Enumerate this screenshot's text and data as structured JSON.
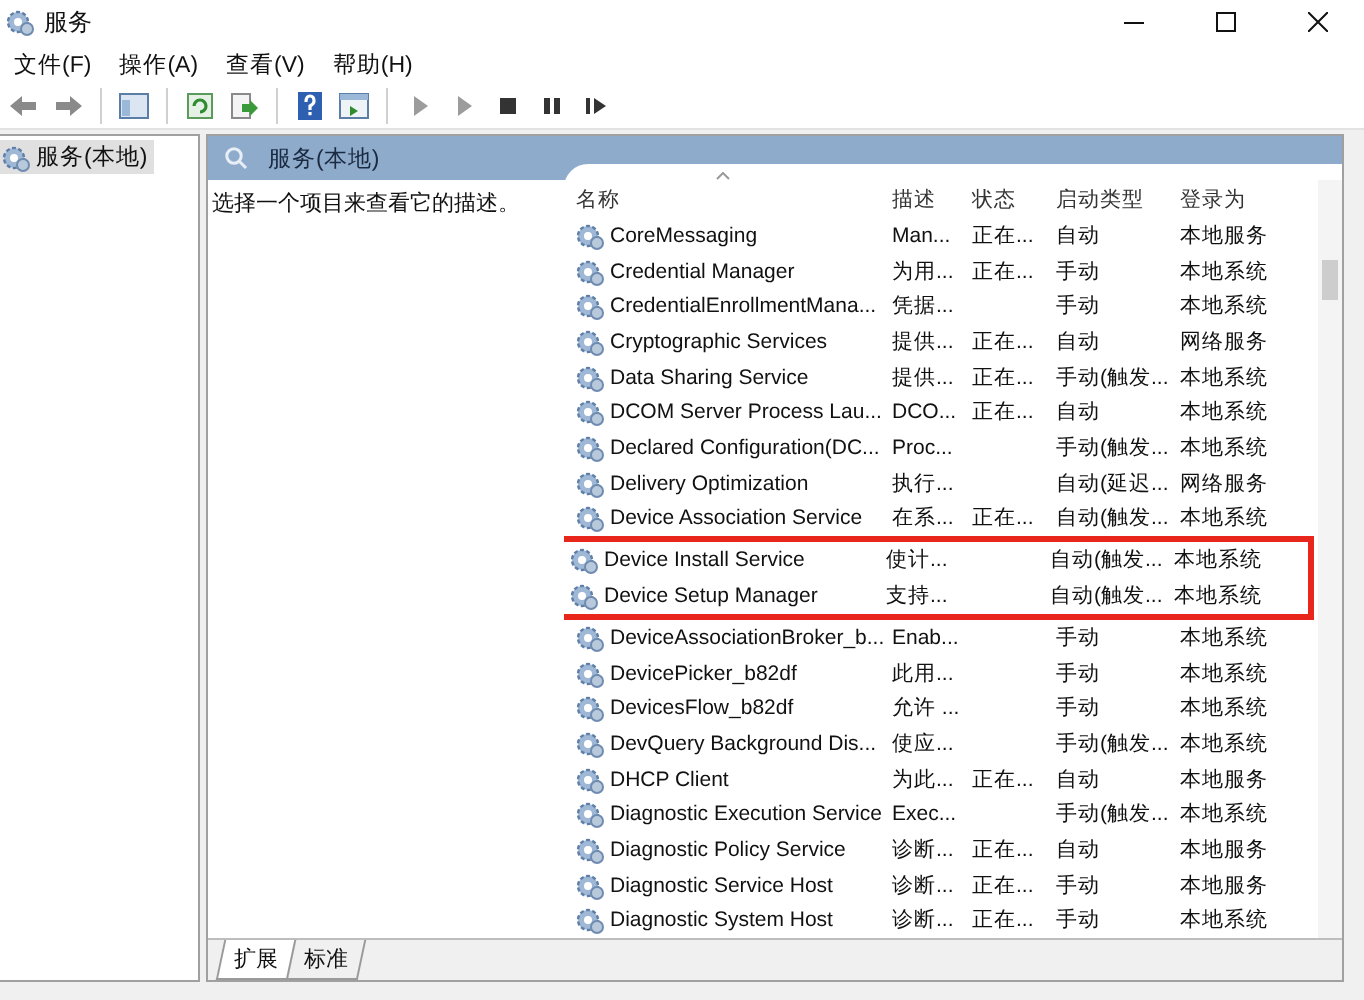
{
  "window": {
    "title": "服务"
  },
  "menu": [
    {
      "label": "文件(F)"
    },
    {
      "label": "操作(A)"
    },
    {
      "label": "查看(V)"
    },
    {
      "label": "帮助(H)"
    }
  ],
  "toolbar": [
    {
      "kind": "back",
      "disabled": false
    },
    {
      "kind": "forward",
      "disabled": false
    },
    {
      "kind": "sep"
    },
    {
      "kind": "tree",
      "disabled": false
    },
    {
      "kind": "sep"
    },
    {
      "kind": "refresh",
      "disabled": false
    },
    {
      "kind": "export",
      "disabled": false
    },
    {
      "kind": "sep"
    },
    {
      "kind": "help",
      "disabled": false
    },
    {
      "kind": "properties",
      "disabled": false
    },
    {
      "kind": "sep"
    },
    {
      "kind": "play",
      "disabled": true
    },
    {
      "kind": "play",
      "disabled": true
    },
    {
      "kind": "stop",
      "disabled": false
    },
    {
      "kind": "pause",
      "disabled": false
    },
    {
      "kind": "resume",
      "disabled": false
    }
  ],
  "tree": {
    "items": [
      {
        "label": "服务(本地)",
        "selected": true
      }
    ]
  },
  "panel": {
    "title": "服务(本地)",
    "description": "选择一个项目来查看它的描述。",
    "columns": [
      {
        "label": "名称",
        "sorted": true
      },
      {
        "label": "描述",
        "sorted": false
      },
      {
        "label": "状态",
        "sorted": false
      },
      {
        "label": "启动类型",
        "sorted": false
      },
      {
        "label": "登录为",
        "sorted": false
      }
    ],
    "rows": [
      {
        "name": "CoreMessaging",
        "description": "Man...",
        "status": "正在...",
        "startup": "自动",
        "logon": "本地服务",
        "highlighted": false
      },
      {
        "name": "Credential Manager",
        "description": "为用...",
        "status": "正在...",
        "startup": "手动",
        "logon": "本地系统",
        "highlighted": false
      },
      {
        "name": "CredentialEnrollmentMana...",
        "description": "凭据...",
        "status": "",
        "startup": "手动",
        "logon": "本地系统",
        "highlighted": false
      },
      {
        "name": "Cryptographic Services",
        "description": "提供...",
        "status": "正在...",
        "startup": "自动",
        "logon": "网络服务",
        "highlighted": false
      },
      {
        "name": "Data Sharing Service",
        "description": "提供...",
        "status": "正在...",
        "startup": "手动(触发...",
        "logon": "本地系统",
        "highlighted": false
      },
      {
        "name": "DCOM Server Process Lau...",
        "description": "DCO...",
        "status": "正在...",
        "startup": "自动",
        "logon": "本地系统",
        "highlighted": false
      },
      {
        "name": "Declared Configuration(DC...",
        "description": "Proc...",
        "status": "",
        "startup": "手动(触发...",
        "logon": "本地系统",
        "highlighted": false
      },
      {
        "name": "Delivery Optimization",
        "description": "执行...",
        "status": "",
        "startup": "自动(延迟...",
        "logon": "网络服务",
        "highlighted": false
      },
      {
        "name": "Device Association Service",
        "description": "在系...",
        "status": "正在...",
        "startup": "自动(触发...",
        "logon": "本地系统",
        "highlighted": false
      },
      {
        "name": "Device Install Service",
        "description": "使计...",
        "status": "",
        "startup": "自动(触发...",
        "logon": "本地系统",
        "highlighted": true
      },
      {
        "name": "Device Setup Manager",
        "description": "支持...",
        "status": "",
        "startup": "自动(触发...",
        "logon": "本地系统",
        "highlighted": true
      },
      {
        "name": "DeviceAssociationBroker_b...",
        "description": "Enab...",
        "status": "",
        "startup": "手动",
        "logon": "本地系统",
        "highlighted": false
      },
      {
        "name": "DevicePicker_b82df",
        "description": "此用...",
        "status": "",
        "startup": "手动",
        "logon": "本地系统",
        "highlighted": false
      },
      {
        "name": "DevicesFlow_b82df",
        "description": "允许 ...",
        "status": "",
        "startup": "手动",
        "logon": "本地系统",
        "highlighted": false
      },
      {
        "name": "DevQuery Background Dis...",
        "description": "使应...",
        "status": "",
        "startup": "手动(触发...",
        "logon": "本地系统",
        "highlighted": false
      },
      {
        "name": "DHCP Client",
        "description": "为此...",
        "status": "正在...",
        "startup": "自动",
        "logon": "本地服务",
        "highlighted": false
      },
      {
        "name": "Diagnostic Execution Service",
        "description": "Exec...",
        "status": "",
        "startup": "手动(触发...",
        "logon": "本地系统",
        "highlighted": false
      },
      {
        "name": "Diagnostic Policy Service",
        "description": "诊断...",
        "status": "正在...",
        "startup": "自动",
        "logon": "本地服务",
        "highlighted": false
      },
      {
        "name": "Diagnostic Service Host",
        "description": "诊断...",
        "status": "正在...",
        "startup": "手动",
        "logon": "本地服务",
        "highlighted": false
      },
      {
        "name": "Diagnostic System Host",
        "description": "诊断...",
        "status": "正在...",
        "startup": "手动",
        "logon": "本地系统",
        "highlighted": false
      }
    ],
    "tabs": [
      {
        "label": "扩展",
        "selected": true
      },
      {
        "label": "标准",
        "selected": false
      }
    ]
  }
}
